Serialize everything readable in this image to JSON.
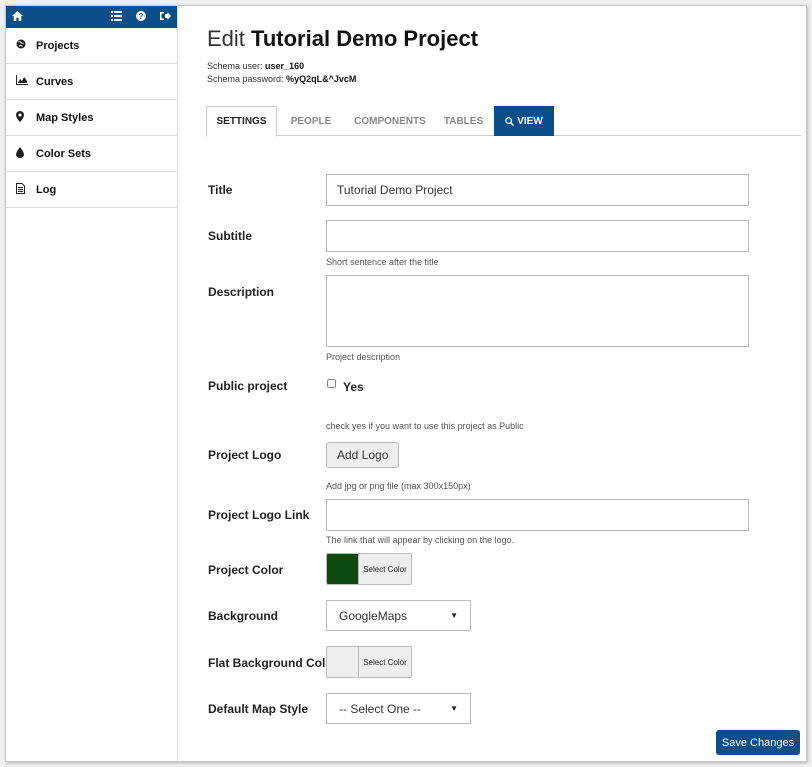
{
  "sidebar": {
    "topbar": {
      "home_icon": "home-icon",
      "icons": [
        "list-icon",
        "help-icon",
        "logout-icon"
      ]
    },
    "items": [
      {
        "label": "Projects",
        "icon": "globe-icon"
      },
      {
        "label": "Curves",
        "icon": "area-chart-icon"
      },
      {
        "label": "Map Styles",
        "icon": "map-marker-icon"
      },
      {
        "label": "Color Sets",
        "icon": "tint-icon"
      },
      {
        "label": "Log",
        "icon": "file-text-icon"
      }
    ]
  },
  "header": {
    "title_prefix": "Edit",
    "title_name": "Tutorial Demo Project",
    "schema_user_label": "Schema user:",
    "schema_user_value": "user_160",
    "schema_password_label": "Schema password:",
    "schema_password_value": "%yQ2qL&^JvcM"
  },
  "tabs": [
    {
      "label": "SETTINGS",
      "active": true
    },
    {
      "label": "PEOPLE"
    },
    {
      "label": "COMPONENTS"
    },
    {
      "label": "TABLES"
    },
    {
      "label": "VIEW",
      "icon": "search-icon"
    }
  ],
  "form": {
    "title_label": "Title",
    "title_value": "Tutorial Demo Project",
    "subtitle_label": "Subtitle",
    "subtitle_value": "",
    "subtitle_help": "Short sentence after the title",
    "description_label": "Description",
    "description_value": "",
    "description_help": "Project description",
    "public_label": "Public project",
    "public_checkbox_label": "Yes",
    "public_checked": false,
    "public_help": "check yes if you want to use this project as Public",
    "logo_label": "Project Logo",
    "logo_button": "Add Logo",
    "logo_help": "Add jpg or png file (max 300x150px)",
    "logo_link_label": "Project Logo Link",
    "logo_link_value": "",
    "logo_link_help": "The link that will appear by clicking on the logo.",
    "color_label": "Project Color",
    "color_value": "#0d4a0d",
    "color_button": "Select Color",
    "background_label": "Background",
    "background_value": "GoogleMaps",
    "flat_bg_label": "Flat Background Color",
    "flat_bg_value": "#eeeeee",
    "flat_bg_button": "Select Color",
    "map_style_label": "Default Map Style",
    "map_style_value": "-- Select One --"
  },
  "actions": {
    "save_label": "Save Changes"
  },
  "colors": {
    "brand": "#0b4f8a"
  }
}
